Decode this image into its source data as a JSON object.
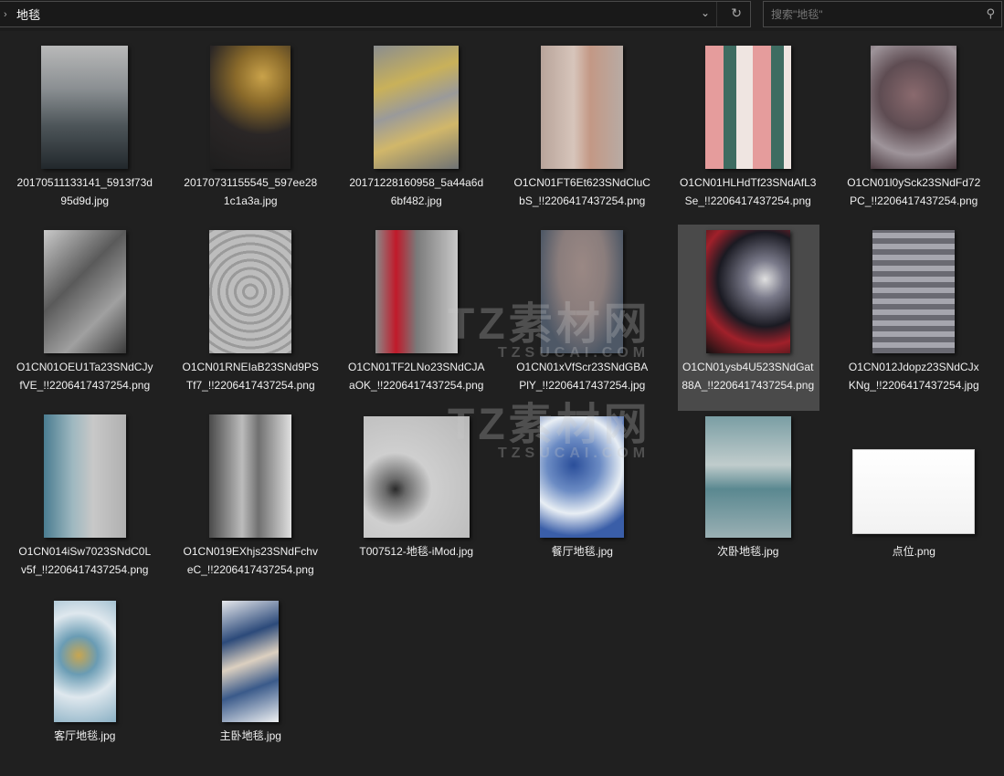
{
  "address": {
    "breadcrumb": "地毯"
  },
  "search": {
    "placeholder": "搜索\"地毯\""
  },
  "watermark": {
    "brand": "TZ素材网",
    "url": "TZSUCAI.COM"
  },
  "files": [
    {
      "name": "20170511133141_5913f73d95d9d.jpg"
    },
    {
      "name": "20170731155545_597ee281c1a3a.jpg"
    },
    {
      "name": "20171228160958_5a44a6d6bf482.jpg"
    },
    {
      "name": "O1CN01FT6Et623SNdCluCbS_!!2206417437254.png"
    },
    {
      "name": "O1CN01HLHdTf23SNdAfL3Se_!!2206417437254.png"
    },
    {
      "name": "O1CN01l0ySck23SNdFd72PC_!!2206417437254.png"
    },
    {
      "name": "O1CN01OEU1Ta23SNdCJyfVE_!!2206417437254.png"
    },
    {
      "name": "O1CN01RNEIaB23SNd9PSTf7_!!2206417437254.png"
    },
    {
      "name": "O1CN01TF2LNo23SNdCJAaOK_!!2206417437254.png"
    },
    {
      "name": "O1CN01xVfScr23SNdGBAPlY_!!2206417437254.jpg"
    },
    {
      "name": "O1CN01ysb4U523SNdGat88A_!!2206417437254.png",
      "selected": true
    },
    {
      "name": "O1CN012Jdopz23SNdCJxKNg_!!2206417437254.jpg"
    },
    {
      "name": "O1CN014iSw7023SNdC0Lv5f_!!2206417437254.png"
    },
    {
      "name": "O1CN019EXhjs23SNdFchveC_!!2206417437254.png"
    },
    {
      "name": "T007512-地毯-iMod.jpg"
    },
    {
      "name": "餐厅地毯.jpg"
    },
    {
      "name": "次卧地毯.jpg"
    },
    {
      "name": "点位.png"
    },
    {
      "name": "客厅地毯.jpg"
    },
    {
      "name": "主卧地毯.jpg"
    }
  ]
}
